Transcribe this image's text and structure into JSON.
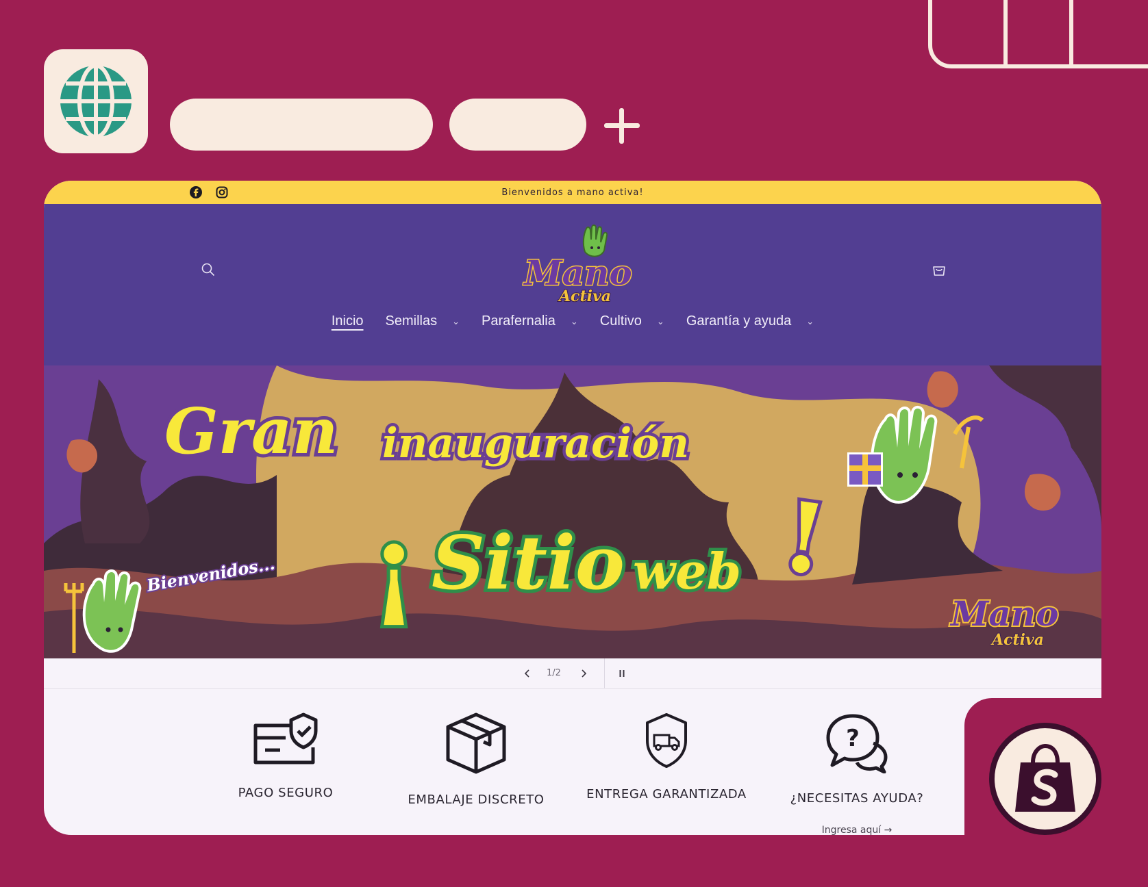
{
  "browser": {
    "globe_icon": "globe-icon",
    "new_tab_icon": "plus-icon"
  },
  "announcement": {
    "text": "Bienvenidos a mano activa!",
    "social": [
      "facebook-icon",
      "instagram-icon"
    ]
  },
  "header": {
    "logo_text": "Mano",
    "logo_subtext": "Activa",
    "nav": [
      {
        "label": "Inicio",
        "active": true
      },
      {
        "label": "Semillas",
        "has_menu": true
      },
      {
        "label": "Parafernalia",
        "has_menu": true
      },
      {
        "label": "Cultivo",
        "has_menu": true
      },
      {
        "label": "Garantía y ayuda",
        "has_menu": true
      }
    ]
  },
  "banner": {
    "line1a": "Gran",
    "line1b": "inauguración",
    "line2a": "¡",
    "line2b": "Sitio",
    "line2c": "web",
    "line2d": "!",
    "welcome": "Bienvenidos...",
    "logo_text": "Mano",
    "logo_subtext": "Activa"
  },
  "slider": {
    "counter": "1/2"
  },
  "features": [
    {
      "label": "PAGO SEGURO",
      "icon": "secure-card-icon"
    },
    {
      "label": "EMBALAJE DISCRETO",
      "icon": "box-icon"
    },
    {
      "label": "ENTREGA GARANTIZADA",
      "icon": "shield-truck-icon"
    },
    {
      "label": "¿NECESITAS AYUDA?",
      "icon": "chat-help-icon",
      "link": "Ingresa aquí →"
    }
  ],
  "colors": {
    "frame": "#9e1e52",
    "cream": "#f9ebe0",
    "announcement": "#fcd34d",
    "header": "#523e92",
    "banner_text": "#f8e83a"
  },
  "shopify_icon": "shopify-bag-icon"
}
